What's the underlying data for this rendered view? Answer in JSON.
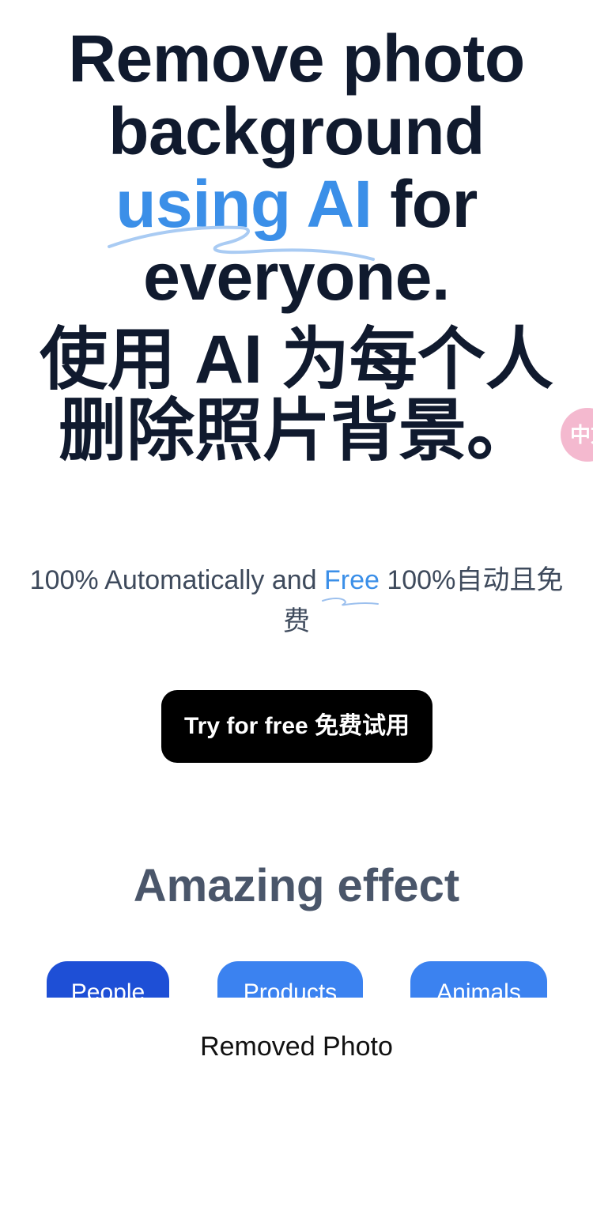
{
  "hero": {
    "title_line1": "Remove photo",
    "title_line2": "background",
    "title_accent": "using AI",
    "title_line3_rest": " for",
    "title_line4": "everyone.",
    "title_cn_line1": "使用 AI 为每个人",
    "title_cn_line2": "删除照片背景。",
    "accent_color": "#3b8fe8",
    "text_color": "#101a2e"
  },
  "side_bubble": {
    "text": "中文",
    "color": "#f4b9cf"
  },
  "subtitle": {
    "before": "100% Automatically and ",
    "free": "Free",
    "after": " 100%自动且免费"
  },
  "cta": {
    "label": "Try for free 免费试用"
  },
  "section": {
    "title": "Amazing effect"
  },
  "tabs": [
    {
      "label": "People",
      "active": true,
      "color": "#1e4fd6"
    },
    {
      "label": "Products",
      "active": false,
      "color": "#3b82f0"
    },
    {
      "label": "Animals",
      "active": false,
      "color": "#3b82f0"
    }
  ],
  "removed": {
    "label": "Removed Photo"
  }
}
